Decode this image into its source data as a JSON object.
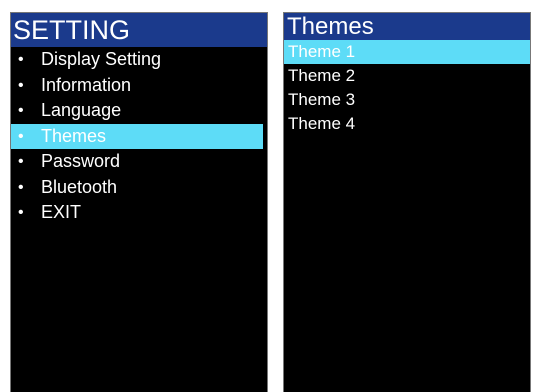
{
  "left_panel": {
    "title": "SETTING",
    "items": [
      {
        "label": "Display Setting",
        "selected": false
      },
      {
        "label": "Information",
        "selected": false
      },
      {
        "label": "Language",
        "selected": false
      },
      {
        "label": "Themes",
        "selected": true
      },
      {
        "label": "Password",
        "selected": false
      },
      {
        "label": "Bluetooth",
        "selected": false
      },
      {
        "label": "EXIT",
        "selected": false
      }
    ],
    "bullet": "•"
  },
  "right_panel": {
    "title": "Themes",
    "items": [
      {
        "label": "Theme 1",
        "selected": true
      },
      {
        "label": "Theme 2",
        "selected": false
      },
      {
        "label": "Theme 3",
        "selected": false
      },
      {
        "label": "Theme 4",
        "selected": false
      }
    ]
  },
  "colors": {
    "title_bar": "#1b3a8c",
    "highlight": "#5ddcf7",
    "screen_background": "#000000",
    "text": "#ffffff"
  }
}
